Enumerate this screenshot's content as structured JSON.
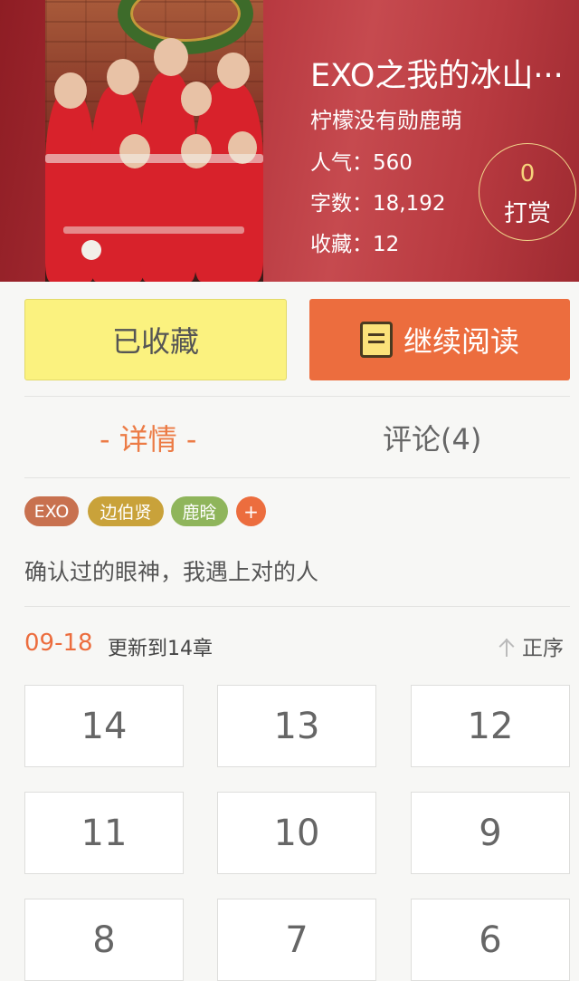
{
  "book": {
    "title": "EXO之我的冰山···",
    "author": "柠檬没有勋鹿萌",
    "stats": [
      {
        "label": "人气：",
        "value": "560"
      },
      {
        "label": "字数：",
        "value": "18,192"
      },
      {
        "label": "收藏：",
        "value": "12"
      }
    ],
    "tip": {
      "count": "0",
      "label": "打赏"
    }
  },
  "actions": {
    "favorite_label": "已收藏",
    "read_label": "继续阅读",
    "read_icon": "book-icon"
  },
  "tabs": {
    "details": "- 详情 -",
    "comments": "评论(4)"
  },
  "tags": [
    {
      "label": "EXO",
      "color": "#c8714f"
    },
    {
      "label": "边伯贤",
      "color": "#c9a23a"
    },
    {
      "label": "鹿晗",
      "color": "#8fb55b"
    },
    {
      "label": "+",
      "color": "#ec6d3e"
    }
  ],
  "description": "确认过的眼神，我遇上对的人",
  "update": {
    "date": "09-18",
    "text": "更新到14章",
    "sort_label": "正序",
    "sort_icon": "arrow-up-icon"
  },
  "chapters": [
    "14",
    "13",
    "12",
    "11",
    "10",
    "9",
    "8",
    "7",
    "6"
  ],
  "colors": {
    "accent": "#ec6d3e",
    "favorite_bg": "#fbf27f",
    "hero_bg": "#b2323a"
  }
}
